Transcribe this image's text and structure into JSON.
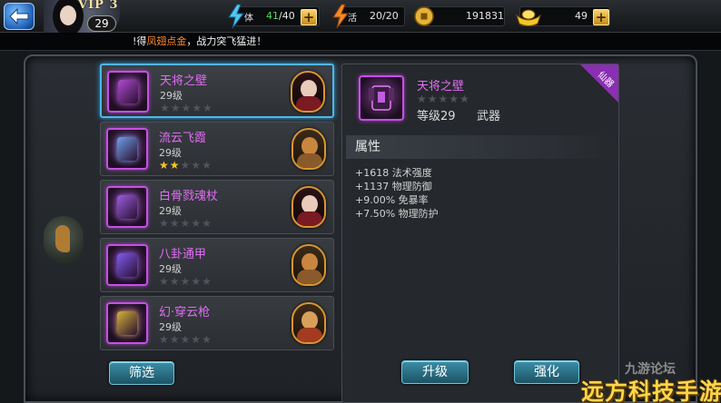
{
  "player": {
    "vip_label": "VIP 3",
    "level": "29"
  },
  "resources": [
    {
      "id": "stamina",
      "icon": "stamina-icon",
      "label": "体",
      "current": "41",
      "max": "/40"
    },
    {
      "id": "energy",
      "icon": "energy-icon",
      "label": "活",
      "value": "20/20"
    },
    {
      "id": "coins",
      "icon": "coin-icon",
      "value": "191831"
    },
    {
      "id": "ingots",
      "icon": "ingot-icon",
      "value": "49"
    }
  ],
  "marquee": {
    "prefix": "!得",
    "highlight": "凤翅点金",
    "suffix": "，战力突飞猛进！"
  },
  "items": [
    {
      "name": "天将之壁",
      "level": "29级",
      "stars": 0,
      "selected": true,
      "icon_color": "#b04bd1",
      "avatar": "female"
    },
    {
      "name": "流云飞霞",
      "level": "29级",
      "stars": 2,
      "selected": false,
      "icon_color": "#6fa0e8",
      "avatar": "monkey"
    },
    {
      "name": "白骨戮魂杖",
      "level": "29级",
      "stars": 0,
      "selected": false,
      "icon_color": "#9b5de0",
      "avatar": "female"
    },
    {
      "name": "八卦通甲",
      "level": "29级",
      "stars": 0,
      "selected": false,
      "icon_color": "#7f5cf0",
      "avatar": "monkey"
    },
    {
      "name": "幻·穿云枪",
      "level": "29级",
      "stars": 0,
      "selected": false,
      "icon_color": "#d4b33a",
      "avatar": "warrior"
    }
  ],
  "detail": {
    "name": "天将之壁",
    "level": "等级29",
    "type": "武器",
    "tag": "仙器",
    "attr_title": "属性",
    "attributes": [
      "+1618 法术强度",
      "+1137 物理防御",
      "+9.00% 免暴率",
      "+7.50% 物理防护"
    ]
  },
  "buttons": {
    "filter": "筛选",
    "upgrade": "升级",
    "enhance": "强化"
  },
  "watermark": {
    "small": "九游论坛",
    "big": "远方科技手游网"
  },
  "colors": {
    "epic": "#e36df5",
    "accent": "#4fb6e8",
    "star_on": "#f5c628",
    "highlight": "#ff8a2a"
  }
}
